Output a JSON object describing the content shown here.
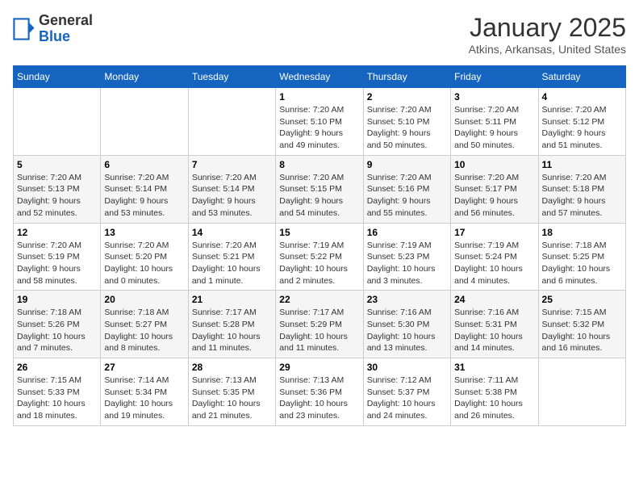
{
  "logo": {
    "general": "General",
    "blue": "Blue"
  },
  "header": {
    "month": "January 2025",
    "location": "Atkins, Arkansas, United States"
  },
  "weekdays": [
    "Sunday",
    "Monday",
    "Tuesday",
    "Wednesday",
    "Thursday",
    "Friday",
    "Saturday"
  ],
  "weeks": [
    [
      {
        "day": "",
        "info": ""
      },
      {
        "day": "",
        "info": ""
      },
      {
        "day": "",
        "info": ""
      },
      {
        "day": "1",
        "info": "Sunrise: 7:20 AM\nSunset: 5:10 PM\nDaylight: 9 hours\nand 49 minutes."
      },
      {
        "day": "2",
        "info": "Sunrise: 7:20 AM\nSunset: 5:10 PM\nDaylight: 9 hours\nand 50 minutes."
      },
      {
        "day": "3",
        "info": "Sunrise: 7:20 AM\nSunset: 5:11 PM\nDaylight: 9 hours\nand 50 minutes."
      },
      {
        "day": "4",
        "info": "Sunrise: 7:20 AM\nSunset: 5:12 PM\nDaylight: 9 hours\nand 51 minutes."
      }
    ],
    [
      {
        "day": "5",
        "info": "Sunrise: 7:20 AM\nSunset: 5:13 PM\nDaylight: 9 hours\nand 52 minutes."
      },
      {
        "day": "6",
        "info": "Sunrise: 7:20 AM\nSunset: 5:14 PM\nDaylight: 9 hours\nand 53 minutes."
      },
      {
        "day": "7",
        "info": "Sunrise: 7:20 AM\nSunset: 5:14 PM\nDaylight: 9 hours\nand 53 minutes."
      },
      {
        "day": "8",
        "info": "Sunrise: 7:20 AM\nSunset: 5:15 PM\nDaylight: 9 hours\nand 54 minutes."
      },
      {
        "day": "9",
        "info": "Sunrise: 7:20 AM\nSunset: 5:16 PM\nDaylight: 9 hours\nand 55 minutes."
      },
      {
        "day": "10",
        "info": "Sunrise: 7:20 AM\nSunset: 5:17 PM\nDaylight: 9 hours\nand 56 minutes."
      },
      {
        "day": "11",
        "info": "Sunrise: 7:20 AM\nSunset: 5:18 PM\nDaylight: 9 hours\nand 57 minutes."
      }
    ],
    [
      {
        "day": "12",
        "info": "Sunrise: 7:20 AM\nSunset: 5:19 PM\nDaylight: 9 hours\nand 58 minutes."
      },
      {
        "day": "13",
        "info": "Sunrise: 7:20 AM\nSunset: 5:20 PM\nDaylight: 10 hours\nand 0 minutes."
      },
      {
        "day": "14",
        "info": "Sunrise: 7:20 AM\nSunset: 5:21 PM\nDaylight: 10 hours\nand 1 minute."
      },
      {
        "day": "15",
        "info": "Sunrise: 7:19 AM\nSunset: 5:22 PM\nDaylight: 10 hours\nand 2 minutes."
      },
      {
        "day": "16",
        "info": "Sunrise: 7:19 AM\nSunset: 5:23 PM\nDaylight: 10 hours\nand 3 minutes."
      },
      {
        "day": "17",
        "info": "Sunrise: 7:19 AM\nSunset: 5:24 PM\nDaylight: 10 hours\nand 4 minutes."
      },
      {
        "day": "18",
        "info": "Sunrise: 7:18 AM\nSunset: 5:25 PM\nDaylight: 10 hours\nand 6 minutes."
      }
    ],
    [
      {
        "day": "19",
        "info": "Sunrise: 7:18 AM\nSunset: 5:26 PM\nDaylight: 10 hours\nand 7 minutes."
      },
      {
        "day": "20",
        "info": "Sunrise: 7:18 AM\nSunset: 5:27 PM\nDaylight: 10 hours\nand 8 minutes."
      },
      {
        "day": "21",
        "info": "Sunrise: 7:17 AM\nSunset: 5:28 PM\nDaylight: 10 hours\nand 11 minutes."
      },
      {
        "day": "22",
        "info": "Sunrise: 7:17 AM\nSunset: 5:29 PM\nDaylight: 10 hours\nand 11 minutes."
      },
      {
        "day": "23",
        "info": "Sunrise: 7:16 AM\nSunset: 5:30 PM\nDaylight: 10 hours\nand 13 minutes."
      },
      {
        "day": "24",
        "info": "Sunrise: 7:16 AM\nSunset: 5:31 PM\nDaylight: 10 hours\nand 14 minutes."
      },
      {
        "day": "25",
        "info": "Sunrise: 7:15 AM\nSunset: 5:32 PM\nDaylight: 10 hours\nand 16 minutes."
      }
    ],
    [
      {
        "day": "26",
        "info": "Sunrise: 7:15 AM\nSunset: 5:33 PM\nDaylight: 10 hours\nand 18 minutes."
      },
      {
        "day": "27",
        "info": "Sunrise: 7:14 AM\nSunset: 5:34 PM\nDaylight: 10 hours\nand 19 minutes."
      },
      {
        "day": "28",
        "info": "Sunrise: 7:13 AM\nSunset: 5:35 PM\nDaylight: 10 hours\nand 21 minutes."
      },
      {
        "day": "29",
        "info": "Sunrise: 7:13 AM\nSunset: 5:36 PM\nDaylight: 10 hours\nand 23 minutes."
      },
      {
        "day": "30",
        "info": "Sunrise: 7:12 AM\nSunset: 5:37 PM\nDaylight: 10 hours\nand 24 minutes."
      },
      {
        "day": "31",
        "info": "Sunrise: 7:11 AM\nSunset: 5:38 PM\nDaylight: 10 hours\nand 26 minutes."
      },
      {
        "day": "",
        "info": ""
      }
    ]
  ]
}
